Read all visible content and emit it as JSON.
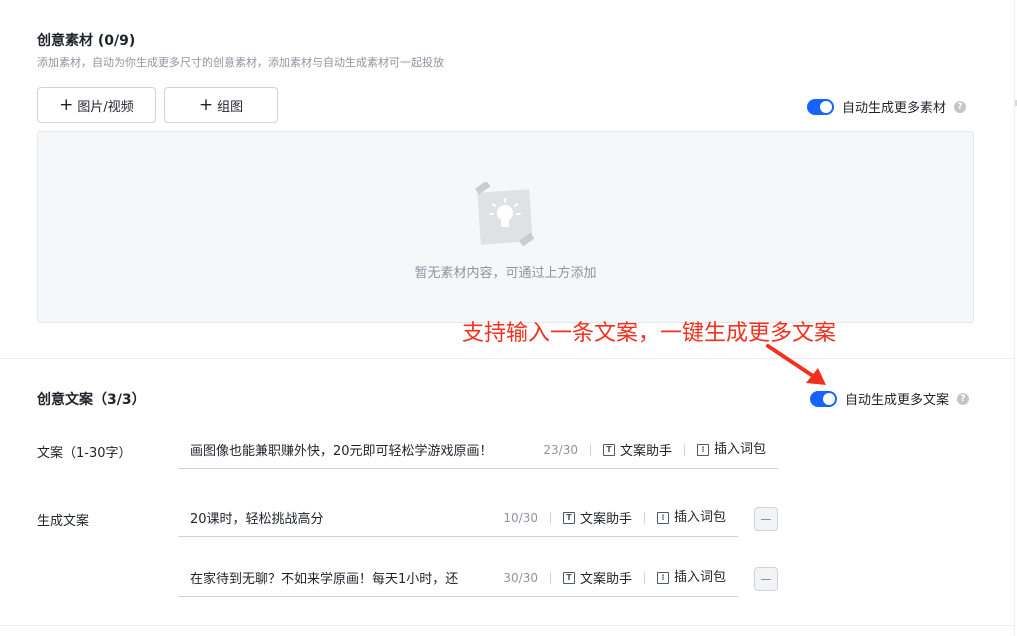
{
  "material": {
    "title": "创意素材 (0/9)",
    "subtitle": "添加素材，自动为你生成更多尺寸的创意素材，添加素材与自动生成素材可一起投放",
    "buttons": [
      {
        "label": "图片/视频"
      },
      {
        "label": "组图"
      }
    ],
    "toggle_label": "自动生成更多素材",
    "toggle_on": true,
    "empty_text": "暂无素材内容，可通过上方添加"
  },
  "annotation": "支持输入一条文案，一键生成更多文案",
  "copy": {
    "title": "创意文案（3/3）",
    "toggle_label": "自动生成更多文案",
    "toggle_on": true,
    "tools": {
      "assistant": "文案助手",
      "insert": "插入词包"
    },
    "rows": [
      {
        "label": "文案（1-30字）",
        "value": "画图像也能兼职赚外快，20元即可轻松学游戏原画！",
        "count": "23/30"
      },
      {
        "label": "生成文案",
        "value": "20课时，轻松挑战高分",
        "count": "10/30"
      },
      {
        "label": "",
        "value": "在家待到无聊？不如来学原画！每天1小时，还",
        "count": "30/30"
      }
    ]
  },
  "colors": {
    "accent": "#1664ff",
    "annotation": "#f2301f"
  }
}
